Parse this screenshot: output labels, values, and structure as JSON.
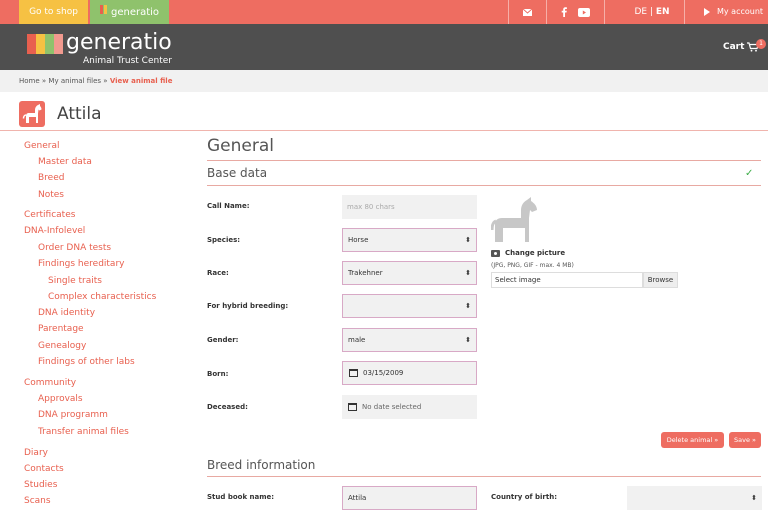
{
  "topbar": {
    "shop_label": "Go to shop",
    "generatio_tab": "generatio",
    "lang_de": "DE",
    "lang_sep": " | ",
    "lang_en": "EN",
    "account_label": "My account",
    "icons": [
      "envelope-icon",
      "facebook-icon",
      "youtube-icon",
      "play-icon"
    ]
  },
  "header": {
    "logo_name": "generatio",
    "logo_sub": "Animal Trust Center",
    "cart_label": "Cart",
    "cart_count": "1",
    "logo_colors": [
      "#e8604f",
      "#f6c143",
      "#8fc26c",
      "#f19a8f"
    ]
  },
  "breadcrumb": {
    "home": "Home",
    "sep": " » ",
    "files": "My animal files",
    "current": "View animal file"
  },
  "page": {
    "title": "Attila"
  },
  "sidebar": {
    "items": [
      {
        "label": "General"
      },
      {
        "label": "Master data"
      },
      {
        "label": "Breed"
      },
      {
        "label": "Notes"
      },
      {
        "label": "Certificates"
      },
      {
        "label": "DNA-Infolevel"
      },
      {
        "label": "Order DNA tests"
      },
      {
        "label": "Findings hereditary"
      },
      {
        "label": "Single traits"
      },
      {
        "label": "Complex characteristics"
      },
      {
        "label": "DNA identity"
      },
      {
        "label": "Parentage"
      },
      {
        "label": "Genealogy"
      },
      {
        "label": "Findings of other labs"
      },
      {
        "label": "Community"
      },
      {
        "label": "Approvals"
      },
      {
        "label": "DNA programm"
      },
      {
        "label": "Transfer animal files"
      },
      {
        "label": "Diary"
      },
      {
        "label": "Contacts"
      },
      {
        "label": "Studies"
      },
      {
        "label": "Scans"
      }
    ]
  },
  "main": {
    "general_heading": "General",
    "base_heading": "Base data",
    "fields": [
      {
        "label": "Call Name:",
        "value": "",
        "placeholder": "max 80 chars"
      },
      {
        "label": "Species:",
        "value": "Horse"
      },
      {
        "label": "Race:",
        "value": "Trakehner"
      },
      {
        "label": "For hybrid breeding:",
        "value": ""
      },
      {
        "label": "Gender:",
        "value": "male"
      },
      {
        "label": "Born:",
        "value": "03/15/2009"
      },
      {
        "label": "Deceased:",
        "value": "",
        "placeholder": "No date selected"
      }
    ],
    "picture": {
      "change_label": "Change picture",
      "hint": "(JPG, PNG, GIF - max. 4 MB)",
      "select_placeholder": "Select image",
      "browse_label": "Browse"
    },
    "delete_label": "Delete animal »",
    "save_label": "Save »",
    "breed_heading": "Breed information",
    "stud_label": "Stud book name:",
    "stud_value": "Attila",
    "country_label": "Country of birth:",
    "country_value": ""
  },
  "colors": {
    "accent": "#ee6d61",
    "shop": "#f6c143",
    "generatio_tab": "#8fc26c",
    "header_bg": "#4f4f4f",
    "success": "#3fae49"
  }
}
